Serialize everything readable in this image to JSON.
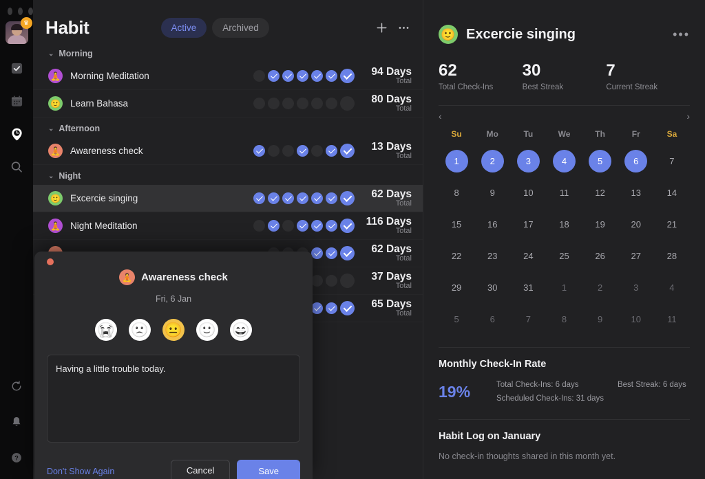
{
  "window": {
    "traffic_lights": [
      "close",
      "minimize",
      "maximize"
    ]
  },
  "rail": {
    "avatar_badge": "♛",
    "items": [
      {
        "name": "checklist",
        "icon": "checkbox-icon",
        "active": false
      },
      {
        "name": "calendar",
        "icon": "calendar-icon",
        "active": false
      },
      {
        "name": "habit",
        "icon": "clock-pin-icon",
        "active": true
      },
      {
        "name": "search",
        "icon": "search-icon",
        "active": false
      }
    ],
    "bottom_items": [
      {
        "name": "sync",
        "icon": "refresh-icon"
      },
      {
        "name": "notifications",
        "icon": "bell-icon"
      },
      {
        "name": "help",
        "icon": "help-icon"
      }
    ]
  },
  "header": {
    "title": "Habit",
    "tabs": [
      {
        "label": "Active",
        "selected": true
      },
      {
        "label": "Archived",
        "selected": false
      }
    ],
    "add_label": "+",
    "more_label": "•••"
  },
  "groups": [
    {
      "label": "Morning",
      "habits": [
        {
          "name": "Morning Meditation",
          "icon": "🧘",
          "icon_bg": "#b24fd4",
          "days": "94 Days",
          "total": "Total",
          "checks": [
            false,
            true,
            true,
            true,
            true,
            true
          ],
          "today": true,
          "selected": false
        },
        {
          "name": "Learn Bahasa",
          "icon": "🙂",
          "icon_bg": "#7ecb6b",
          "days": "80 Days",
          "total": "Total",
          "checks": [
            false,
            false,
            false,
            false,
            false,
            false
          ],
          "today": false,
          "selected": false
        }
      ]
    },
    {
      "label": "Afternoon",
      "habits": [
        {
          "name": "Awareness check",
          "icon": "🧘",
          "icon_bg": "#e8836a",
          "days": "13 Days",
          "total": "Total",
          "checks": [
            true,
            false,
            false,
            true,
            false,
            true
          ],
          "today": true,
          "selected": false
        }
      ]
    },
    {
      "label": "Night",
      "habits": [
        {
          "name": "Excercie singing",
          "icon": "🙂",
          "icon_bg": "#7ecb6b",
          "days": "62 Days",
          "total": "Total",
          "checks": [
            true,
            true,
            true,
            true,
            true,
            true
          ],
          "today": true,
          "selected": true
        },
        {
          "name": "Night Meditation",
          "icon": "🧘",
          "icon_bg": "#b24fd4",
          "days": "116 Days",
          "total": "Total",
          "checks": [
            false,
            true,
            false,
            true,
            true,
            true
          ],
          "today": true,
          "selected": false
        },
        {
          "name": "",
          "icon": "",
          "icon_bg": "#e8836a",
          "days": "62 Days",
          "total": "Total",
          "checks": [
            false,
            false,
            false,
            true,
            true
          ],
          "today": true,
          "selected": false
        },
        {
          "name": "",
          "icon": "",
          "icon_bg": "#7ecb6b",
          "days": "37 Days",
          "total": "Total",
          "checks": [
            false,
            false,
            false,
            false,
            false
          ],
          "today": false,
          "selected": false
        },
        {
          "name": "",
          "icon": "",
          "icon_bg": "#b24fd4",
          "days": "65 Days",
          "total": "Total",
          "checks": [
            false,
            false,
            false,
            true,
            true
          ],
          "today": true,
          "selected": false
        }
      ]
    }
  ],
  "modal": {
    "habit_name": "Awareness check",
    "habit_icon": "🧘",
    "habit_icon_bg": "#e8836a",
    "date": "Fri, 6 Jan",
    "moods": [
      {
        "glyph": "😭",
        "selected": false
      },
      {
        "glyph": "🙁",
        "selected": false
      },
      {
        "glyph": "😐",
        "selected": true
      },
      {
        "glyph": "🙂",
        "selected": false
      },
      {
        "glyph": "😄",
        "selected": false
      }
    ],
    "note_value": "Having a little trouble today.",
    "note_placeholder": "",
    "dont_show_label": "Don't Show Again",
    "cancel_label": "Cancel",
    "save_label": "Save"
  },
  "detail": {
    "title": "Excercie singing",
    "icon": "🙂",
    "icon_bg": "#7ecb6b",
    "more_label": "•••",
    "stats": [
      {
        "value": "62",
        "label": "Total Check-Ins"
      },
      {
        "value": "30",
        "label": "Best Streak"
      },
      {
        "value": "7",
        "label": "Current Streak"
      }
    ],
    "calendar": {
      "prev_label": "‹",
      "next_label": "›",
      "dow": [
        "Su",
        "Mo",
        "Tu",
        "We",
        "Th",
        "Fr",
        "Sa"
      ],
      "weekend_idx": [
        0,
        6
      ],
      "weeks": [
        [
          {
            "d": "1",
            "on": true
          },
          {
            "d": "2",
            "on": true
          },
          {
            "d": "3",
            "on": true
          },
          {
            "d": "4",
            "on": true
          },
          {
            "d": "5",
            "on": true
          },
          {
            "d": "6",
            "on": true
          },
          {
            "d": "7",
            "on": false
          }
        ],
        [
          {
            "d": "8",
            "on": false
          },
          {
            "d": "9",
            "on": false
          },
          {
            "d": "10",
            "on": false
          },
          {
            "d": "11",
            "on": false
          },
          {
            "d": "12",
            "on": false
          },
          {
            "d": "13",
            "on": false
          },
          {
            "d": "14",
            "on": false
          }
        ],
        [
          {
            "d": "15",
            "on": false
          },
          {
            "d": "16",
            "on": false
          },
          {
            "d": "17",
            "on": false
          },
          {
            "d": "18",
            "on": false
          },
          {
            "d": "19",
            "on": false
          },
          {
            "d": "20",
            "on": false
          },
          {
            "d": "21",
            "on": false
          }
        ],
        [
          {
            "d": "22",
            "on": false
          },
          {
            "d": "23",
            "on": false
          },
          {
            "d": "24",
            "on": false
          },
          {
            "d": "25",
            "on": false
          },
          {
            "d": "26",
            "on": false
          },
          {
            "d": "27",
            "on": false
          },
          {
            "d": "28",
            "on": false
          }
        ],
        [
          {
            "d": "29",
            "on": false
          },
          {
            "d": "30",
            "on": false
          },
          {
            "d": "31",
            "on": false
          },
          {
            "d": "1",
            "on": false,
            "out": true
          },
          {
            "d": "2",
            "on": false,
            "out": true
          },
          {
            "d": "3",
            "on": false,
            "out": true
          },
          {
            "d": "4",
            "on": false,
            "out": true
          }
        ],
        [
          {
            "d": "5",
            "on": false,
            "out": true
          },
          {
            "d": "6",
            "on": false,
            "out": true
          },
          {
            "d": "7",
            "on": false,
            "out": true
          },
          {
            "d": "8",
            "on": false,
            "out": true
          },
          {
            "d": "9",
            "on": false,
            "out": true
          },
          {
            "d": "10",
            "on": false,
            "out": true
          },
          {
            "d": "11",
            "on": false,
            "out": true
          }
        ]
      ]
    },
    "rate_section_title": "Monthly Check-In Rate",
    "rate_value": "19%",
    "rate_total": "Total Check-Ins: 6 days",
    "rate_scheduled": "Scheduled Check-Ins: 31 days",
    "rate_best": "Best Streak: 6 days",
    "log_section_title": "Habit Log on January",
    "log_empty": "No check-in thoughts shared in this month yet."
  },
  "colors": {
    "accent": "#6a82e8",
    "weekend": "#d8a73a",
    "panel": "#212123",
    "rail": "#0b0b0c",
    "selected_row": "#333335"
  }
}
